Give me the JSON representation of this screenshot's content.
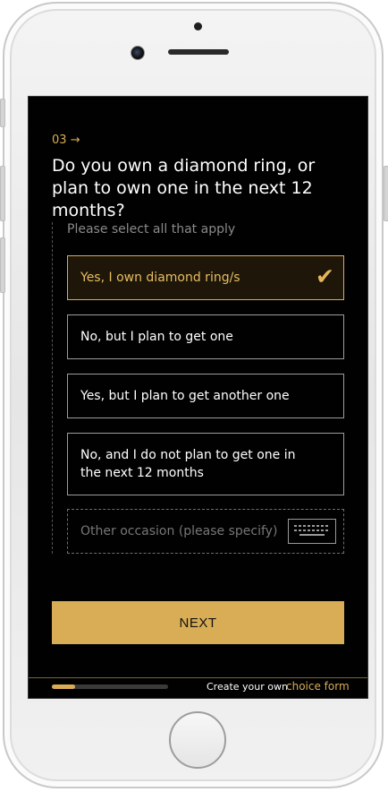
{
  "question": {
    "step_number": "03",
    "step_arrow": "→",
    "text": "Do you own a diamond ring, or plan to own one in the next 12 months?",
    "hint": "Please select all that apply"
  },
  "options": [
    {
      "label": "Yes, I own diamond ring/s",
      "selected": true
    },
    {
      "label": "No, but I plan to get one",
      "selected": false
    },
    {
      "label": "Yes, but I plan to get another one",
      "selected": false
    },
    {
      "label": "No, and I do not plan to get one in the next 12 months",
      "selected": false
    }
  ],
  "other_input": {
    "placeholder": "Other occasion (please specify)"
  },
  "checkmark": "✔",
  "next_button": {
    "label": "NEXT"
  },
  "footer": {
    "brand_prefix": "Create your own",
    "brand_accent": "choice form",
    "progress_percent": 20
  },
  "colors": {
    "accent": "#d9ad55",
    "background": "#010101",
    "option_border": "#9c9c9c"
  }
}
